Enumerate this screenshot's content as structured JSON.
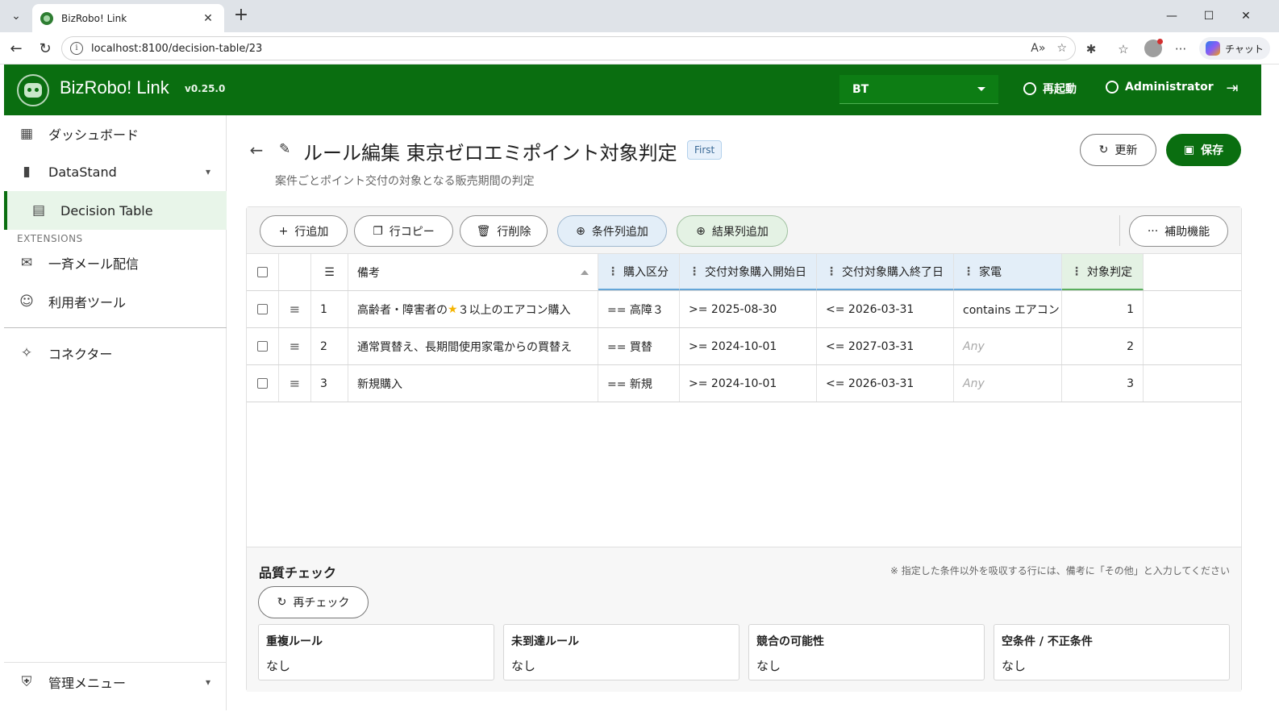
{
  "browser": {
    "tab_title": "BizRobo! Link",
    "url": "localhost:8100/decision-table/23",
    "copilot_label": "チャット"
  },
  "header": {
    "app_name": "BizRobo! Link",
    "version": "v0.25.0",
    "tenant": "BT",
    "restart_label": "再起動",
    "user_label": "Administrator"
  },
  "sidebar": {
    "items": [
      {
        "label": "ダッシュボード"
      },
      {
        "label": "DataStand"
      },
      {
        "label": "Decision Table"
      }
    ],
    "extensions_heading": "EXTENSIONS",
    "extensions": [
      {
        "label": "一斉メール配信"
      },
      {
        "label": "利用者ツール"
      }
    ],
    "connector": {
      "label": "コネクター"
    },
    "admin": {
      "label": "管理メニュー"
    }
  },
  "page": {
    "title": "ルール編集 東京ゼロエミポイント対象判定",
    "badge": "First",
    "subtitle": "案件ごとポイント交付の対象となる販売期間の判定",
    "refresh_label": "更新",
    "save_label": "保存"
  },
  "toolbar": {
    "add_row": "行追加",
    "copy_row": "行コピー",
    "delete_row": "行削除",
    "add_condition": "条件列追加",
    "add_result": "結果列追加",
    "helper": "補助機能"
  },
  "table": {
    "columns": {
      "note": "備考",
      "c1": "購入区分",
      "c2": "交付対象購入開始日",
      "c3": "交付対象購入終了日",
      "c4": "家電",
      "r1": "対象判定"
    },
    "rows": [
      {
        "no": "1",
        "note_a": "高齢者・障害者の",
        "note_star": "★",
        "note_b": "３以上のエアコン購入",
        "c1": "== 高障３",
        "c2": ">= 2025-08-30",
        "c3": "<= 2026-03-31",
        "c4": "contains エアコン",
        "c4_any": "",
        "r1": "1"
      },
      {
        "no": "2",
        "note_a": "通常買替え、長期間使用家電からの買替え",
        "note_star": "",
        "note_b": "",
        "c1": "== 買替",
        "c2": ">= 2024-10-01",
        "c3": "<= 2027-03-31",
        "c4": "",
        "c4_any": "Any",
        "r1": "2"
      },
      {
        "no": "3",
        "note_a": "新規購入",
        "note_star": "",
        "note_b": "",
        "c1": "== 新規",
        "c2": ">= 2024-10-01",
        "c3": "<= 2026-03-31",
        "c4": "",
        "c4_any": "Any",
        "r1": "3"
      }
    ]
  },
  "quality": {
    "title": "品質チェック",
    "note": "※ 指定した条件以外を吸収する行には、備考に「その他」と入力してください",
    "recheck_label": "再チェック",
    "boxes": [
      {
        "title": "重複ルール",
        "value": "なし"
      },
      {
        "title": "未到達ルール",
        "value": "なし"
      },
      {
        "title": "競合の可能性",
        "value": "なし"
      },
      {
        "title": "空条件 / 不正条件",
        "value": "なし"
      }
    ]
  },
  "colors": {
    "brand_green": "#0a6e10",
    "condition_col_bg": "#e3eef8",
    "result_col_bg": "#e4f2e4"
  }
}
